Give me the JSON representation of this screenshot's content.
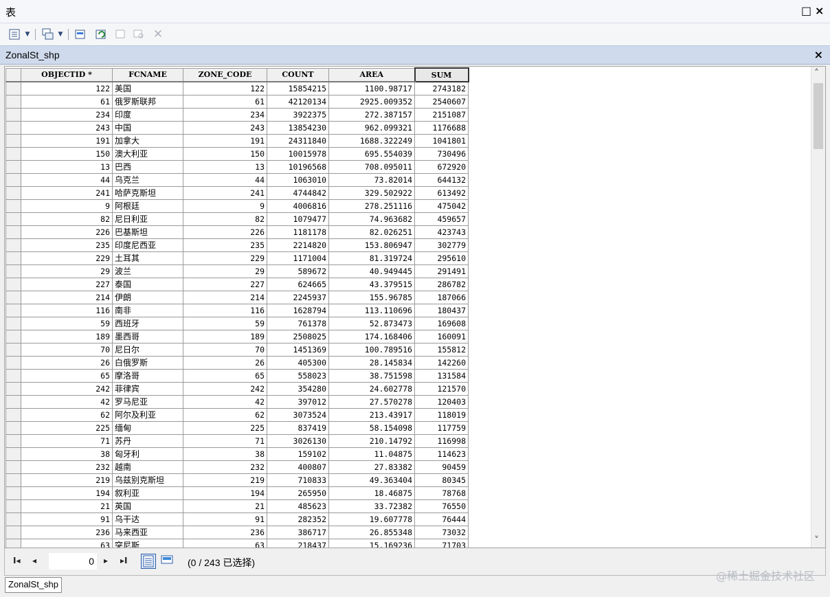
{
  "window": {
    "title": "表",
    "restore_label": "□",
    "close_label": "×"
  },
  "toolbar": {
    "table_options_icon": "table-options-icon",
    "related_tables_icon": "related-tables-icon",
    "select_by_attributes_icon": "select-by-attributes-icon",
    "switch_selection_icon": "switch-selection-icon",
    "clear_selection_icon": "clear-selection-icon",
    "zoom_to_selected_icon": "zoom-to-selected-icon",
    "delete_selected_icon": "delete-selected-icon"
  },
  "tab": {
    "name": "ZonalSt_shp",
    "close_label": "×"
  },
  "grid": {
    "columns": [
      "OBJECTID *",
      "FCNAME",
      "ZONE_CODE",
      "COUNT",
      "AREA",
      "SUM"
    ],
    "rows": [
      [
        "122",
        "美国",
        "122",
        "15854215",
        "1100.98717",
        "2743182"
      ],
      [
        "61",
        "俄罗斯联邦",
        "61",
        "42120134",
        "2925.009352",
        "2540607"
      ],
      [
        "234",
        "印度",
        "234",
        "3922375",
        "272.387157",
        "2151087"
      ],
      [
        "243",
        "中国",
        "243",
        "13854230",
        "962.099321",
        "1176688"
      ],
      [
        "191",
        "加拿大",
        "191",
        "24311840",
        "1688.322249",
        "1041801"
      ],
      [
        "150",
        "澳大利亚",
        "150",
        "10015978",
        "695.554039",
        "730496"
      ],
      [
        "13",
        "巴西",
        "13",
        "10196568",
        "708.095011",
        "672920"
      ],
      [
        "44",
        "乌克兰",
        "44",
        "1063010",
        "73.82014",
        "644132"
      ],
      [
        "241",
        "哈萨克斯坦",
        "241",
        "4744842",
        "329.502922",
        "613492"
      ],
      [
        "9",
        "阿根廷",
        "9",
        "4006816",
        "278.251116",
        "475042"
      ],
      [
        "82",
        "尼日利亚",
        "82",
        "1079477",
        "74.963682",
        "459657"
      ],
      [
        "226",
        "巴基斯坦",
        "226",
        "1181178",
        "82.026251",
        "423743"
      ],
      [
        "235",
        "印度尼西亚",
        "235",
        "2214820",
        "153.806947",
        "302779"
      ],
      [
        "229",
        "土耳其",
        "229",
        "1171004",
        "81.319724",
        "295610"
      ],
      [
        "29",
        "波兰",
        "29",
        "589672",
        "40.949445",
        "291491"
      ],
      [
        "227",
        "泰国",
        "227",
        "624665",
        "43.379515",
        "286782"
      ],
      [
        "214",
        "伊朗",
        "214",
        "2245937",
        "155.96785",
        "187066"
      ],
      [
        "116",
        "南非",
        "116",
        "1628794",
        "113.110696",
        "180437"
      ],
      [
        "59",
        "西班牙",
        "59",
        "761378",
        "52.873473",
        "169608"
      ],
      [
        "189",
        "墨西哥",
        "189",
        "2508025",
        "174.168406",
        "160091"
      ],
      [
        "70",
        "尼日尔",
        "70",
        "1451369",
        "100.789516",
        "155812"
      ],
      [
        "26",
        "白俄罗斯",
        "26",
        "405300",
        "28.145834",
        "142260"
      ],
      [
        "65",
        "摩洛哥",
        "65",
        "558023",
        "38.751598",
        "131584"
      ],
      [
        "242",
        "菲律宾",
        "242",
        "354280",
        "24.602778",
        "121570"
      ],
      [
        "42",
        "罗马尼亚",
        "42",
        "397012",
        "27.570278",
        "120403"
      ],
      [
        "62",
        "阿尔及利亚",
        "62",
        "3073524",
        "213.43917",
        "118019"
      ],
      [
        "225",
        "缅甸",
        "225",
        "837419",
        "58.154098",
        "117759"
      ],
      [
        "71",
        "苏丹",
        "71",
        "3026130",
        "210.14792",
        "116998"
      ],
      [
        "38",
        "匈牙利",
        "38",
        "159102",
        "11.04875",
        "114623"
      ],
      [
        "232",
        "越南",
        "232",
        "400807",
        "27.83382",
        "90459"
      ],
      [
        "219",
        "乌兹别克斯坦",
        "219",
        "710833",
        "49.363404",
        "80345"
      ],
      [
        "194",
        "叙利亚",
        "194",
        "265950",
        "18.46875",
        "78768"
      ],
      [
        "21",
        "英国",
        "21",
        "485623",
        "33.72382",
        "76550"
      ],
      [
        "91",
        "乌干达",
        "91",
        "282352",
        "19.607778",
        "76444"
      ],
      [
        "236",
        "马来西亚",
        "236",
        "386717",
        "26.855348",
        "73032"
      ],
      [
        "63",
        "突尼斯",
        "63",
        "218437",
        "15.169236",
        "71703"
      ]
    ]
  },
  "navigation": {
    "first_label": "I◂",
    "prev_label": "◂",
    "record_value": "0",
    "next_label": "▸",
    "last_label": "▸I",
    "status": "(0 / 243 已选择)"
  },
  "bottom_tab": {
    "label": "ZonalSt_shp"
  },
  "watermark": "@稀土掘金技术社区"
}
